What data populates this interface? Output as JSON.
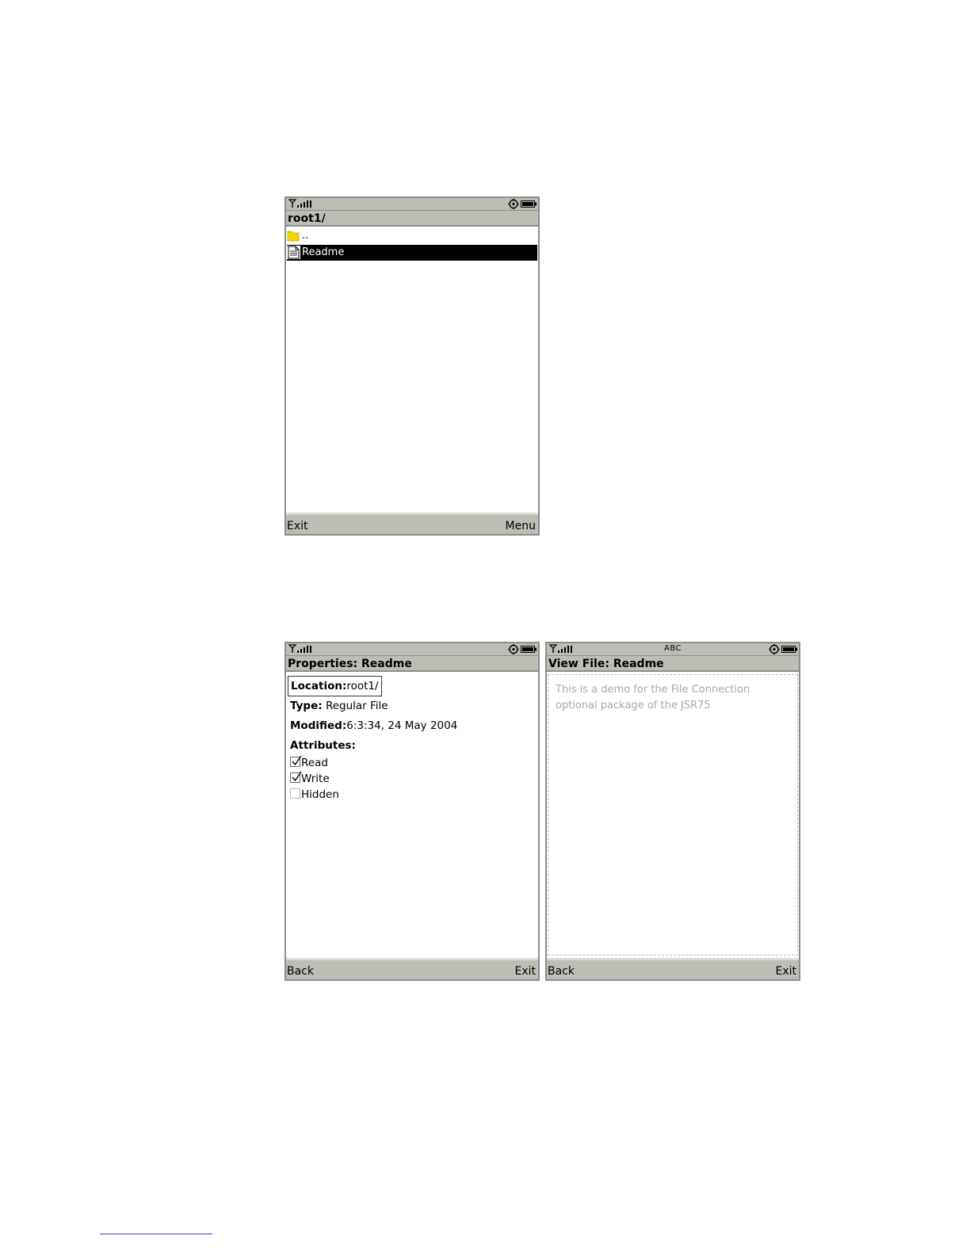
{
  "screens": {
    "browser": {
      "title": "root1/",
      "items": [
        {
          "icon": "folder-icon",
          "label": ".."
        },
        {
          "icon": "document-icon",
          "label": "Readme",
          "selected": true
        }
      ],
      "softkeys": {
        "left": "Exit",
        "right": "Menu"
      }
    },
    "properties": {
      "title": "Properties: Readme",
      "location": {
        "label": "Location:",
        "value": "root1/"
      },
      "type": {
        "label": "Type:",
        "value": "Regular File"
      },
      "modified": {
        "label": "Modified:",
        "value": "6:3:34, 24 May 2004"
      },
      "attributes_label": "Attributes:",
      "attributes": [
        {
          "label": "Read",
          "checked": true
        },
        {
          "label": "Write",
          "checked": true
        },
        {
          "label": "Hidden",
          "checked": false
        }
      ],
      "softkeys": {
        "left": "Back",
        "right": "Exit"
      }
    },
    "view": {
      "mode_indicator": "ABC",
      "title": "View File: Readme",
      "text": "This is a demo for the File Connection optional package of the JSR75",
      "softkeys": {
        "left": "Back",
        "right": "Exit"
      }
    }
  },
  "colors": {
    "bar": "#bdbdb6",
    "border": "#8c8c8c",
    "selection": "#000000",
    "folder": "#f3d400",
    "disabled_text": "#a8a8a8"
  }
}
